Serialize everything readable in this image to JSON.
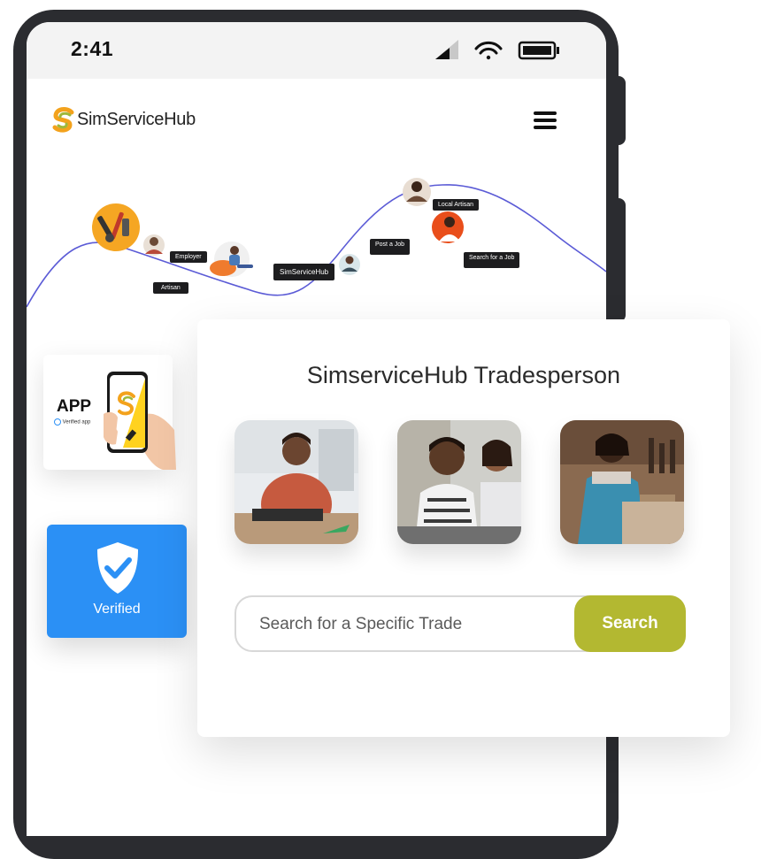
{
  "status_bar": {
    "time": "2:41"
  },
  "header": {
    "logo_text": "SimServiceHub"
  },
  "journey": {
    "labels": {
      "employer": "Employer",
      "artisan": "Artisan",
      "brand": "SimServiceHub",
      "post_job": "Post a Job",
      "local_artisan": "Local Artisan",
      "search_job": "Search for a Job"
    }
  },
  "app_badge": {
    "label": "APP",
    "sub": "Verified app"
  },
  "verified_badge": {
    "label": "Verified"
  },
  "card": {
    "title": "SimserviceHub Tradesperson",
    "photos": [
      "tailor-photo",
      "business-meeting-photo",
      "woodworker-photo"
    ],
    "search": {
      "placeholder": "Search for a Specific Trade",
      "button": "Search"
    }
  },
  "colors": {
    "accent": "#b3b831",
    "verified": "#2b90f5",
    "curve": "#5b5bd6",
    "logo_orange": "#f3a21c",
    "logo_green": "#9fb83a"
  }
}
